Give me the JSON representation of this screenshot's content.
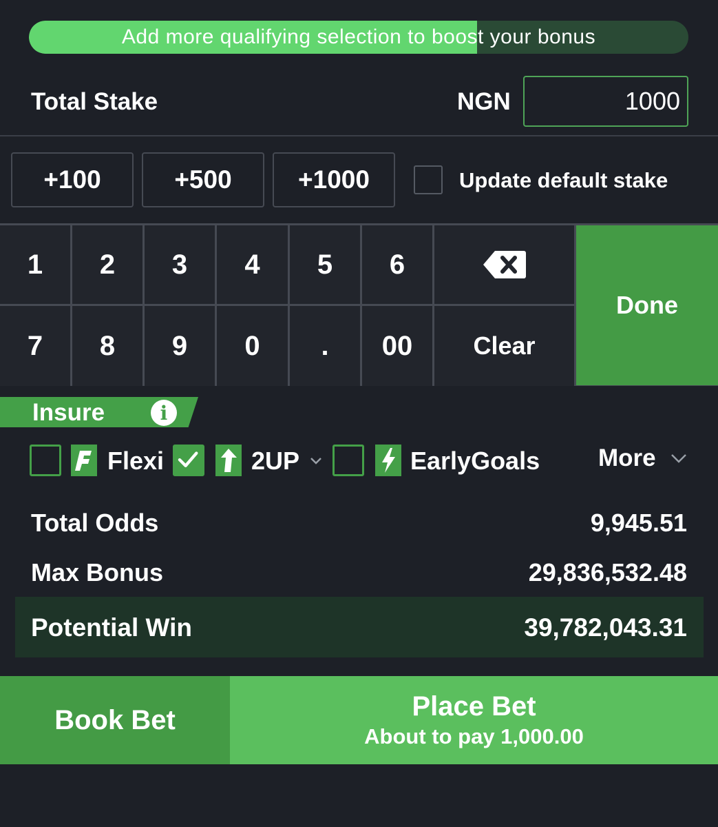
{
  "bonus_banner": {
    "text": "Add more qualifying selection to boost your bonus",
    "progress_percent": 68
  },
  "stake": {
    "label": "Total Stake",
    "currency": "NGN",
    "value": "1000"
  },
  "quick_add": {
    "buttons": [
      "+100",
      "+500",
      "+1000"
    ],
    "default_stake_label": "Update default stake",
    "default_stake_checked": false
  },
  "keypad": {
    "row1": [
      "1",
      "2",
      "3",
      "4",
      "5",
      "6"
    ],
    "row2": [
      "7",
      "8",
      "9",
      "0",
      ".",
      "00"
    ],
    "backspace_icon": "backspace-icon",
    "clear_label": "Clear",
    "done_label": "Done"
  },
  "insure": {
    "label": "Insure",
    "info_icon": "info-icon",
    "options": [
      {
        "label": "Flexi",
        "checked": false,
        "icon": "flexi-icon"
      },
      {
        "label": "2UP",
        "checked": true,
        "icon": "twoup-arrow-icon"
      },
      {
        "label": "EarlyGoals",
        "checked": false,
        "icon": "lightning-icon"
      }
    ],
    "more_label": "More"
  },
  "summary": {
    "total_odds_label": "Total Odds",
    "total_odds_value": "9,945.51",
    "max_bonus_label": "Max Bonus",
    "max_bonus_value": "29,836,532.48",
    "potential_win_label": "Potential Win",
    "potential_win_value": "39,782,043.31"
  },
  "actions": {
    "book_bet_label": "Book Bet",
    "place_bet_label": "Place Bet",
    "place_bet_sub": "About to pay 1,000.00"
  },
  "colors": {
    "background": "#1d2027",
    "accent_green": "#449b45",
    "bright_green": "#5bbf5e",
    "potential_row": "#1e3428"
  }
}
